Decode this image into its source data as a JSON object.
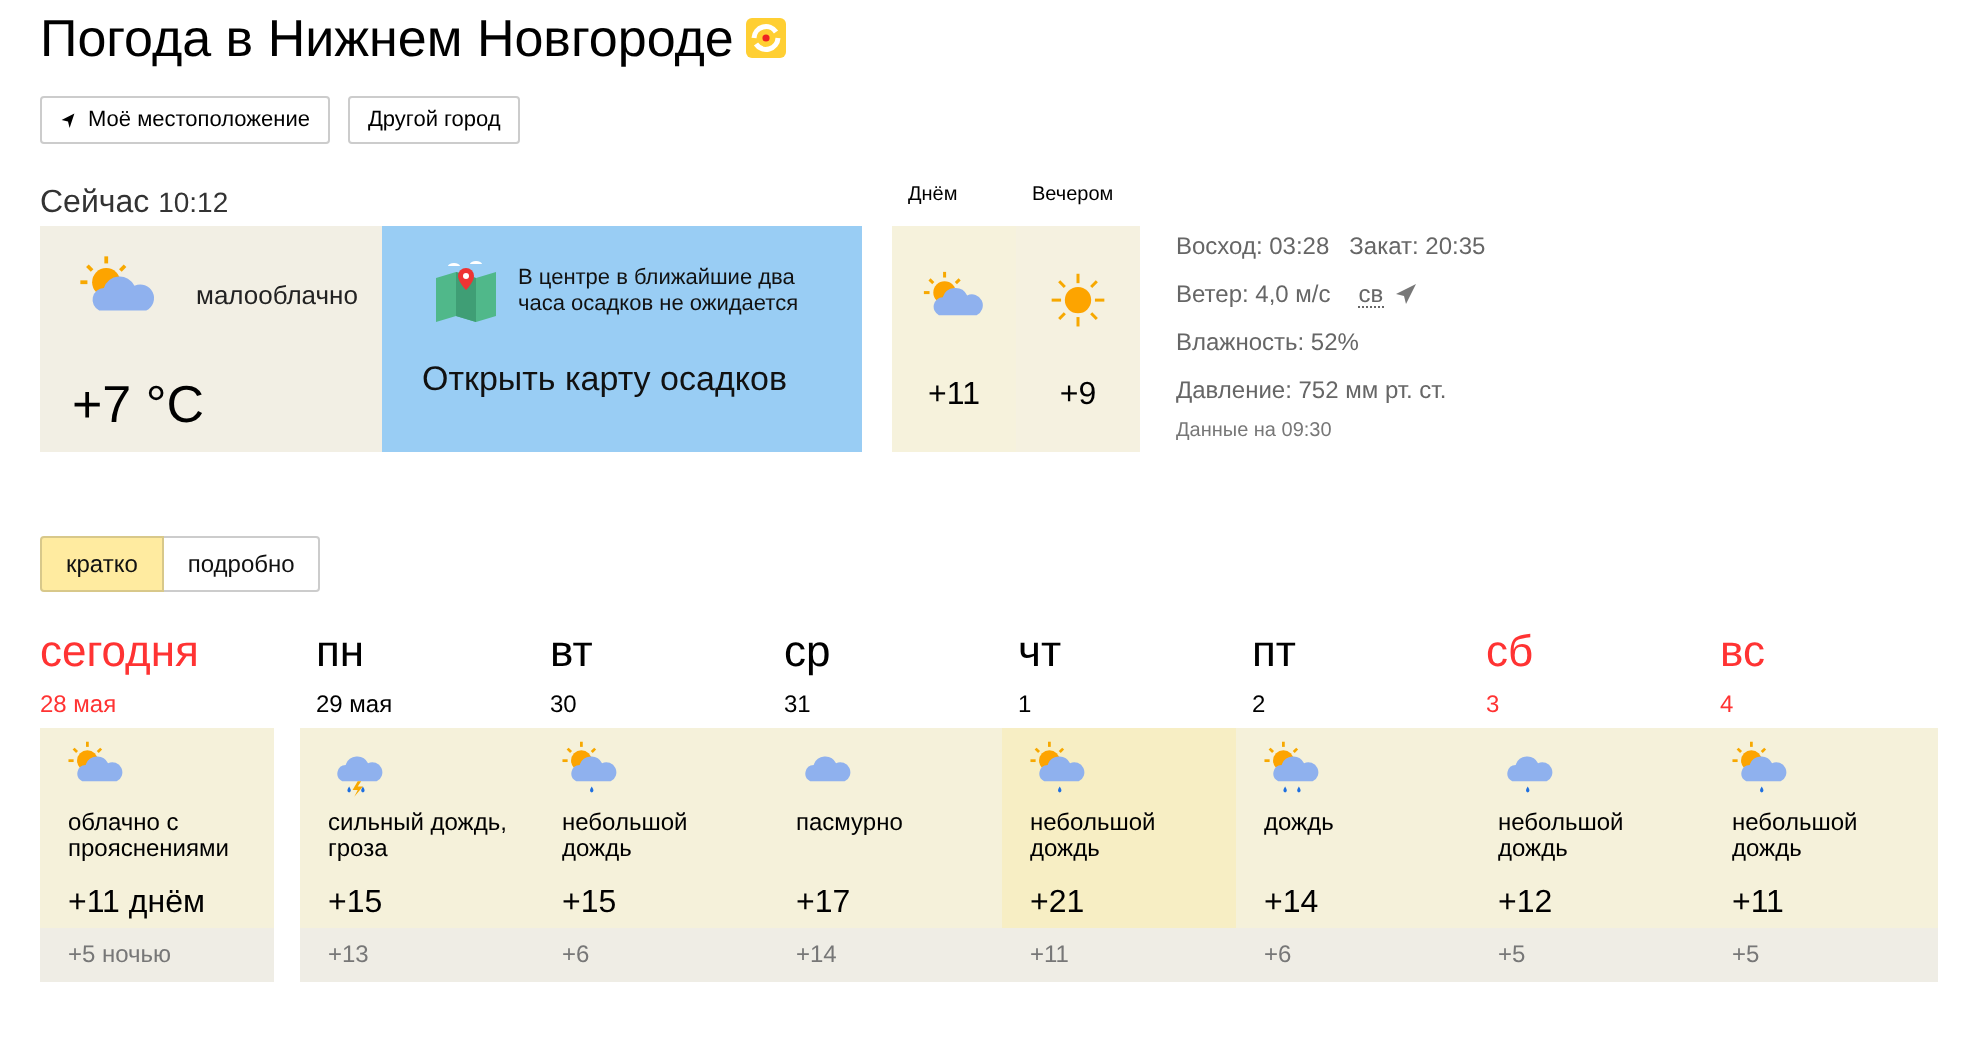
{
  "title": "Погода в Нижнем Новгороде",
  "buttons": [
    {
      "label": "Моё местоположение",
      "kind": "location"
    },
    {
      "label": "Другой город",
      "kind": "plain"
    }
  ],
  "now": {
    "heading": "Сейчас",
    "time": "10:12",
    "kind": "sun-cloud",
    "condition": "малооблачно",
    "temperature": "+7 °C"
  },
  "map": {
    "note": "В центре в ближайшие два часа осадков не ожидается",
    "link": "Открыть карту осадков"
  },
  "parts": [
    {
      "label": "Днём",
      "kind": "sun-cloud",
      "temperature": "+11"
    },
    {
      "label": "Вечером",
      "kind": "sun",
      "temperature": "+9"
    }
  ],
  "details": {
    "sunrise": "Восход: 03:28",
    "sunset": "Закат: 20:35",
    "wind": "Ветер: 4,0 м/с",
    "wind_dir": "св",
    "humidity": "Влажность: 52%",
    "pressure": "Давление: 752 мм рт. ст.",
    "updated": "Данные на 09:30"
  },
  "view_tabs": [
    {
      "label": "кратко",
      "selected": true
    },
    {
      "label": "подробно",
      "selected": false
    }
  ],
  "days": [
    {
      "name": "сегодня",
      "date": "28 мая",
      "red": true,
      "kind": "sun-cloud",
      "condition": "облачно с прояснениями",
      "day": "+11 днём",
      "night": "+5 ночью",
      "highlight": false
    },
    {
      "name": "пн",
      "date": "29 мая",
      "red": false,
      "kind": "storm",
      "condition": "сильный дождь, гроза",
      "day": "+15",
      "night": "+13",
      "highlight": false
    },
    {
      "name": "вт",
      "date": "30",
      "red": false,
      "kind": "sun-cloud-drop",
      "condition": "небольшой дождь",
      "day": "+15",
      "night": "+6",
      "highlight": false
    },
    {
      "name": "ср",
      "date": "31",
      "red": false,
      "kind": "cloud",
      "condition": "пасмурно",
      "day": "+17",
      "night": "+14",
      "highlight": false
    },
    {
      "name": "чт",
      "date": "1",
      "red": false,
      "kind": "sun-cloud-drop",
      "condition": "небольшой дождь",
      "day": "+21",
      "night": "+11",
      "highlight": true
    },
    {
      "name": "пт",
      "date": "2",
      "red": false,
      "kind": "sun-cloud-rain",
      "condition": "дождь",
      "day": "+14",
      "night": "+6",
      "highlight": false
    },
    {
      "name": "сб",
      "date": "3",
      "red": true,
      "kind": "cloud-drop",
      "condition": "небольшой дождь",
      "day": "+12",
      "night": "+5",
      "highlight": false
    },
    {
      "name": "вс",
      "date": "4",
      "red": true,
      "kind": "sun-cloud-drop",
      "condition": "небольшой дождь",
      "day": "+11",
      "night": "+5",
      "highlight": false
    }
  ]
}
